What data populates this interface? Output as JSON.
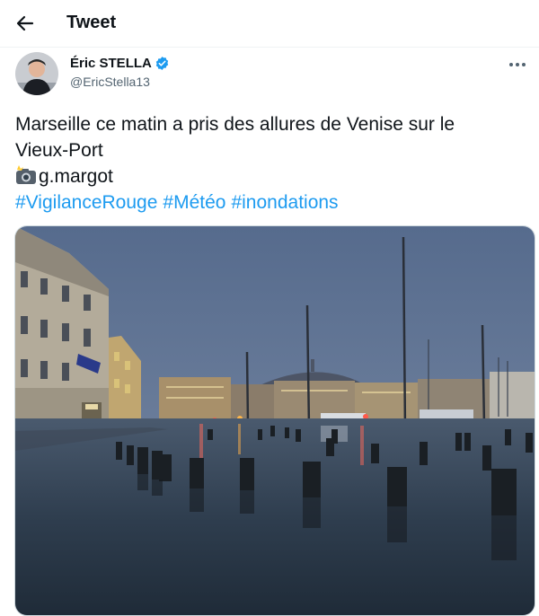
{
  "header": {
    "title": "Tweet"
  },
  "author": {
    "name": "Éric STELLA",
    "handle": "@EricStella13"
  },
  "tweet": {
    "line1": "Marseille ce matin a pris des allures de Venise sur le",
    "line2": "Vieux-Port",
    "credit": "g.margot",
    "hashtags": [
      "#VigilanceRouge",
      "#Météo",
      "#inondations"
    ]
  },
  "icons": {
    "back": "back-arrow-icon",
    "verified": "verified-badge-icon",
    "more": "more-options-icon",
    "camera": "camera-flash-emoji"
  },
  "colors": {
    "link": "#1d9bf0",
    "verified": "#1d9bf0",
    "secondary": "#536471"
  }
}
